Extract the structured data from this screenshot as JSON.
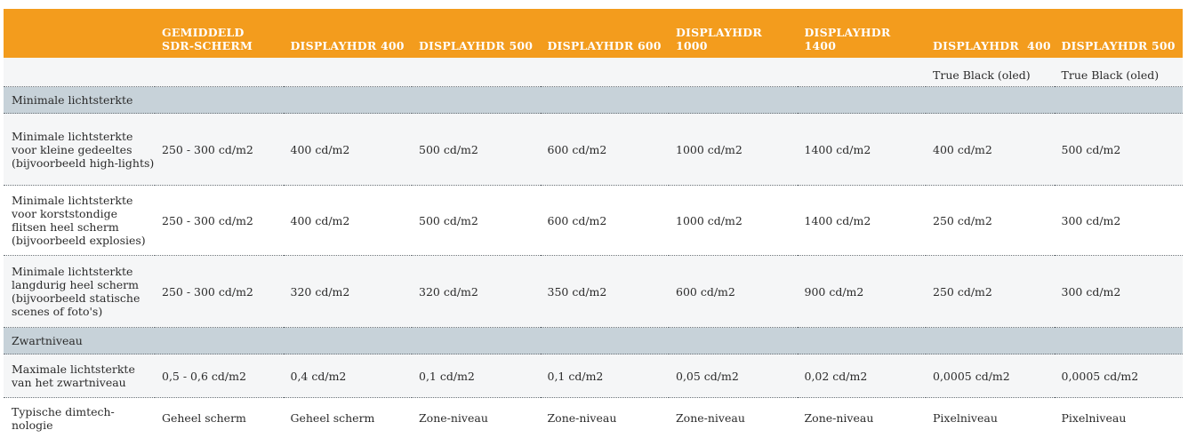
{
  "header": {
    "cols": [
      "",
      "GEMIDDELD\nSDR-SCHERM",
      "DISPLAYHDR 400",
      "DISPLAYHDR 500",
      "DISPLAYHDR 600",
      "DISPLAYHDR 1000",
      "DISPLAYHDR 1400",
      "DISPLAYHDR  400",
      "DISPLAYHDR 500"
    ]
  },
  "subheader": {
    "cols": [
      "",
      "",
      "",
      "",
      "",
      "",
      "",
      "True Black (oled)",
      "True Black (oled)"
    ]
  },
  "sections": {
    "brightness": "Minimale lichtsterkte",
    "black": "Zwartniveau"
  },
  "rows": [
    {
      "label": "Minimale lichtsterkte voor kleine gedeeltes (bijvoorbeeld high-lights)",
      "values": [
        "250 - 300 cd/m2",
        "400 cd/m2",
        "500 cd/m2",
        "600 cd/m2",
        "1000 cd/m2",
        "1400 cd/m2",
        "400 cd/m2",
        "500 cd/m2"
      ]
    },
    {
      "label": "Minimale lichtsterkte voor korststondige flitsen heel scherm (bijvoorbeeld explosies)",
      "values": [
        "250 - 300 cd/m2",
        "400 cd/m2",
        "500 cd/m2",
        "600 cd/m2",
        "1000 cd/m2",
        "1400 cd/m2",
        "250 cd/m2",
        "300 cd/m2"
      ]
    },
    {
      "label": "Minimale lichtsterkte langdurig heel scherm (bijvoorbeeld statische scenes of foto's)",
      "values": [
        "250 - 300 cd/m2",
        "320 cd/m2",
        "320 cd/m2",
        "350 cd/m2",
        "600 cd/m2",
        "900 cd/m2",
        "250 cd/m2",
        "300 cd/m2"
      ]
    },
    {
      "label": "Maximale lichtsterkte van het zwartniveau",
      "values": [
        "0,5 - 0,6 cd/m2",
        "0,4 cd/m2",
        "0,1 cd/m2",
        "0,1 cd/m2",
        "0,05 cd/m2",
        "0,02 cd/m2",
        "0,0005 cd/m2",
        "0,0005 cd/m2"
      ]
    },
    {
      "label": "Typische dimtech-nologie",
      "values": [
        "Geheel scherm",
        "Geheel scherm",
        "Zone-niveau",
        "Zone-niveau",
        "Zone-niveau",
        "Zone-niveau",
        "Pixelniveau",
        "Pixelniveau"
      ]
    }
  ]
}
